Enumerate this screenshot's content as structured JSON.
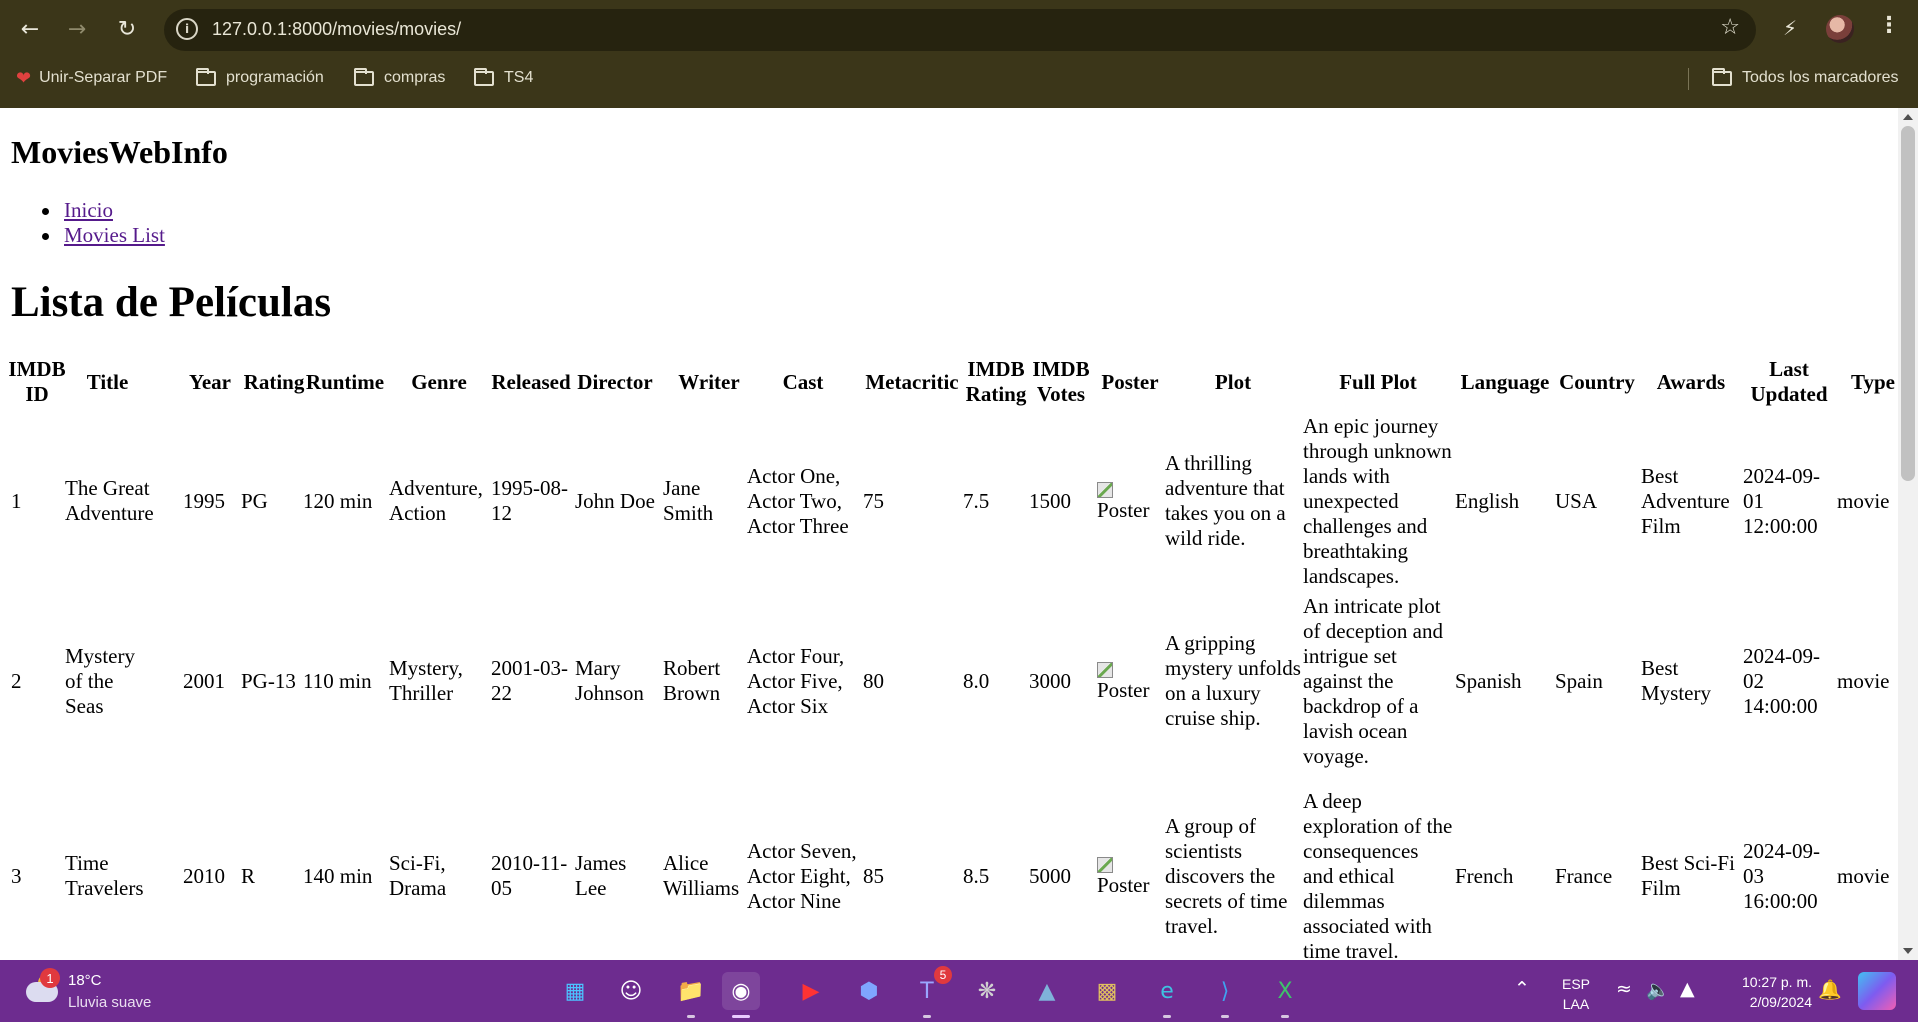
{
  "browser": {
    "url": "127.0.0.1:8000/movies/movies/",
    "bookmarks": [
      {
        "label": "Unir-Separar PDF",
        "icon": "heart-icon"
      },
      {
        "label": "programación",
        "icon": "folder-icon"
      },
      {
        "label": "compras",
        "icon": "folder-icon"
      },
      {
        "label": "TS4",
        "icon": "folder-icon"
      }
    ],
    "all_bookmarks_label": "Todos los marcadores"
  },
  "page": {
    "site_title": "MoviesWebInfo",
    "nav_links": [
      "Inicio",
      "Movies List"
    ],
    "heading": "Lista de Películas",
    "table": {
      "headers": [
        "IMDB ID",
        "Title",
        "Year",
        "Rating",
        "Runtime",
        "Genre",
        "Released",
        "Director",
        "Writer",
        "Cast",
        "Metacritic",
        "IMDB Rating",
        "IMDB Votes",
        "Poster",
        "Plot",
        "Full Plot",
        "Language",
        "Country",
        "Awards",
        "Last Updated",
        "Type"
      ],
      "rows": [
        [
          "1",
          "The Great Adventure",
          "1995",
          "PG",
          "120 min",
          "Adventure, Action",
          "1995-08-12",
          "John Doe",
          "Jane Smith",
          "Actor One, Actor Two, Actor Three",
          "75",
          "7.5",
          "1500",
          "Poster",
          "A thrilling adventure that takes you on a wild ride.",
          "An epic journey through unknown lands with unexpected challenges and breathtaking landscapes.",
          "English",
          "USA",
          "Best Adventure Film",
          "2024-09-01 12:00:00",
          "movie"
        ],
        [
          "2",
          "Mystery of the Seas",
          "2001",
          "PG-13",
          "110 min",
          "Mystery, Thriller",
          "2001-03-22",
          "Mary Johnson",
          "Robert Brown",
          "Actor Four, Actor Five, Actor Six",
          "80",
          "8.0",
          "3000",
          "Poster",
          "A gripping mystery unfolds on a luxury cruise ship.",
          "An intricate plot of deception and intrigue set against the backdrop of a lavish ocean voyage.",
          "Spanish",
          "Spain",
          "Best Mystery",
          "2024-09-02 14:00:00",
          "movie"
        ],
        [
          "3",
          "Time Travelers",
          "2010",
          "R",
          "140 min",
          "Sci-Fi, Drama",
          "2010-11-05",
          "James Lee",
          "Alice Williams",
          "Actor Seven, Actor Eight, Actor Nine",
          "85",
          "8.5",
          "5000",
          "Poster",
          "A group of scientists discovers the secrets of time travel.",
          "A deep exploration of the consequences and ethical dilemmas associated with time travel.",
          "French",
          "France",
          "Best Sci-Fi Film",
          "2024-09-03 16:00:00",
          "movie"
        ]
      ]
    }
  },
  "taskbar": {
    "weather_badge": "1",
    "weather_temp": "18°C",
    "weather_desc": "Lluvia suave",
    "apps": [
      {
        "name": "windows-start-icon"
      },
      {
        "name": "emoji-app-icon"
      },
      {
        "name": "file-explorer-icon"
      },
      {
        "name": "chrome-icon"
      },
      {
        "name": "youtube-music-icon"
      },
      {
        "name": "copilot-icon"
      },
      {
        "name": "teams-icon",
        "badge": "5"
      },
      {
        "name": "network-app-icon"
      },
      {
        "name": "mysql-workbench-icon"
      },
      {
        "name": "chip-app-icon"
      },
      {
        "name": "edge-icon"
      },
      {
        "name": "vscode-icon"
      },
      {
        "name": "excel-icon"
      }
    ],
    "lang_top": "ESP",
    "lang_bottom": "LAA",
    "time": "10:27 p. m.",
    "date": "2/09/2024"
  }
}
